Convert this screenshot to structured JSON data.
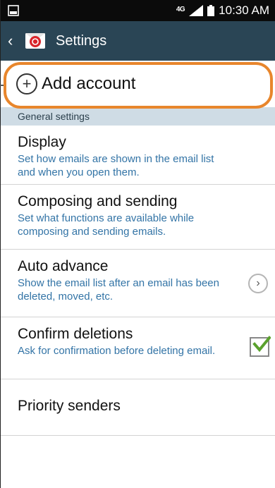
{
  "status_bar": {
    "network": "4G",
    "time": "10:30 AM",
    "icons": [
      "gallery-notification-icon",
      "signal-icon",
      "battery-icon"
    ]
  },
  "action_bar": {
    "back_icon": "chevron-left-icon",
    "app_icon": "email-app-icon",
    "title": "Settings"
  },
  "add_account": {
    "icon": "add-circle-icon",
    "label": "Add account",
    "highlight_color": "#e8862c"
  },
  "section": {
    "label": "General settings"
  },
  "items": [
    {
      "title": "Display",
      "desc": "Set how emails are shown in the email list and when you open them."
    },
    {
      "title": "Composing and sending",
      "desc": "Set what functions are available while composing and sending emails."
    },
    {
      "title": "Auto advance",
      "desc": "Show the email list after an email has been deleted, moved, etc.",
      "control": "chevron-right-icon"
    },
    {
      "title": "Confirm deletions",
      "desc": "Ask for confirmation before deleting email.",
      "control": "checkbox",
      "checked": true
    },
    {
      "title": "Priority senders"
    }
  ],
  "colors": {
    "action_bar": "#2a4555",
    "section_header": "#cfdce5",
    "description_text": "#3374a6",
    "checkmark": "#5aa12d"
  }
}
